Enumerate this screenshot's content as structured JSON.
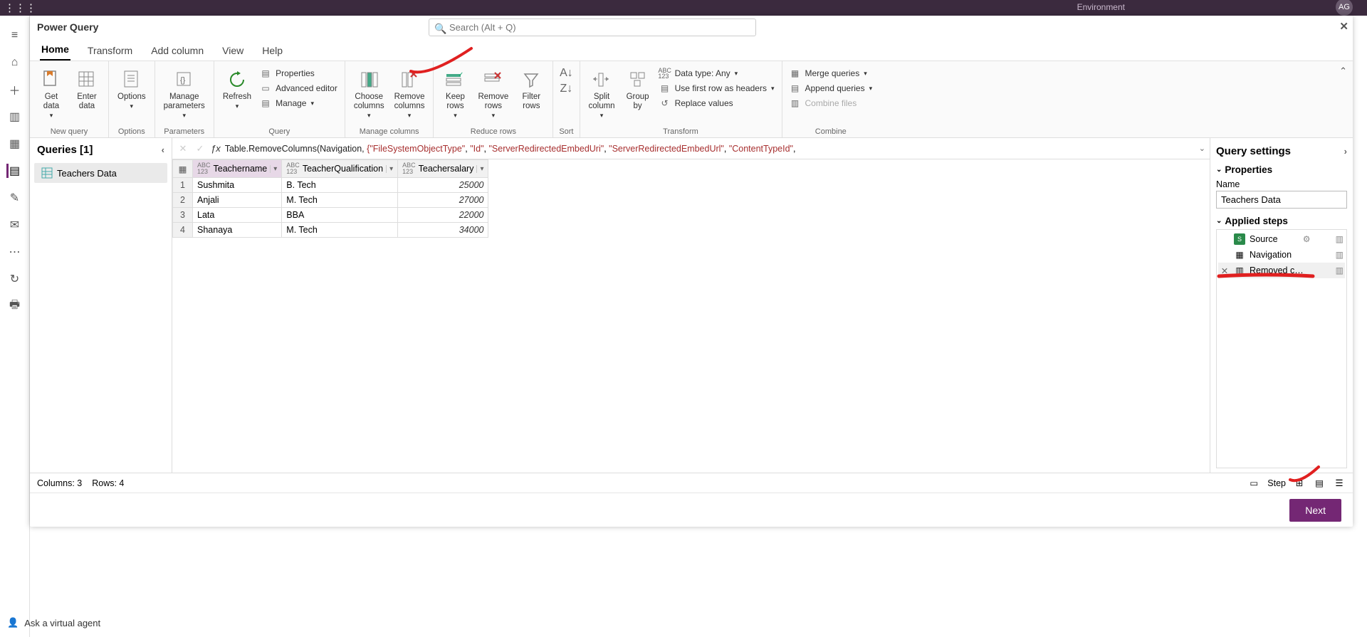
{
  "chrome": {
    "environment": "Environment",
    "avatar": "AG"
  },
  "title": "Power Query",
  "search": {
    "placeholder": "Search (Alt + Q)"
  },
  "tabs": {
    "home": "Home",
    "transform": "Transform",
    "addcol": "Add column",
    "view": "View",
    "help": "Help"
  },
  "ribbon": {
    "getdata": "Get\ndata",
    "enterdata": "Enter\ndata",
    "options": "Options",
    "manageparams": "Manage\nparameters",
    "refresh": "Refresh",
    "properties": "Properties",
    "advanced": "Advanced editor",
    "manage": "Manage",
    "choosecols": "Choose\ncolumns",
    "removecols": "Remove\ncolumns",
    "keeprows": "Keep\nrows",
    "removerows": "Remove\nrows",
    "filterrows": "Filter\nrows",
    "splitcol": "Split\ncolumn",
    "groupby": "Group\nby",
    "datatype": "Data type: Any",
    "firstrow": "Use first row as headers",
    "replace": "Replace values",
    "merge": "Merge queries",
    "append": "Append queries",
    "combine": "Combine files",
    "g_newquery": "New query",
    "g_options": "Options",
    "g_parameters": "Parameters",
    "g_query": "Query",
    "g_managecols": "Manage columns",
    "g_reducerows": "Reduce rows",
    "g_sort": "Sort",
    "g_transform": "Transform",
    "g_combine": "Combine"
  },
  "queries": {
    "header": "Queries [1]",
    "item1": "Teachers Data"
  },
  "formula": {
    "prefix": "Table.RemoveColumns(Navigation, ",
    "s1": "\"FileSystemObjectType\"",
    "s2": "\"Id\"",
    "s3": "\"ServerRedirectedEmbedUri\"",
    "s4": "\"ServerRedirectedEmbedUrl\"",
    "s5": "\"ContentTypeId\""
  },
  "columns": {
    "c1": "Teachername",
    "c2": "TeacherQualification",
    "c3": "Teachersalary"
  },
  "rows": [
    {
      "n": "1",
      "name": "Sushmita",
      "qual": "B. Tech",
      "sal": "25000"
    },
    {
      "n": "2",
      "name": "Anjali",
      "qual": "M. Tech",
      "sal": "27000"
    },
    {
      "n": "3",
      "name": "Lata",
      "qual": "BBA",
      "sal": "22000"
    },
    {
      "n": "4",
      "name": "Shanaya",
      "qual": "M. Tech",
      "sal": "34000"
    }
  ],
  "settings": {
    "header": "Query settings",
    "properties": "Properties",
    "name_label": "Name",
    "name_value": "Teachers Data",
    "applied": "Applied steps",
    "step1": "Source",
    "step2": "Navigation",
    "step3": "Removed c…"
  },
  "status": {
    "cols": "Columns: 3",
    "rows": "Rows: 4",
    "step": "Step"
  },
  "footer": {
    "next": "Next"
  },
  "bottom_agent": "Ask a virtual agent"
}
